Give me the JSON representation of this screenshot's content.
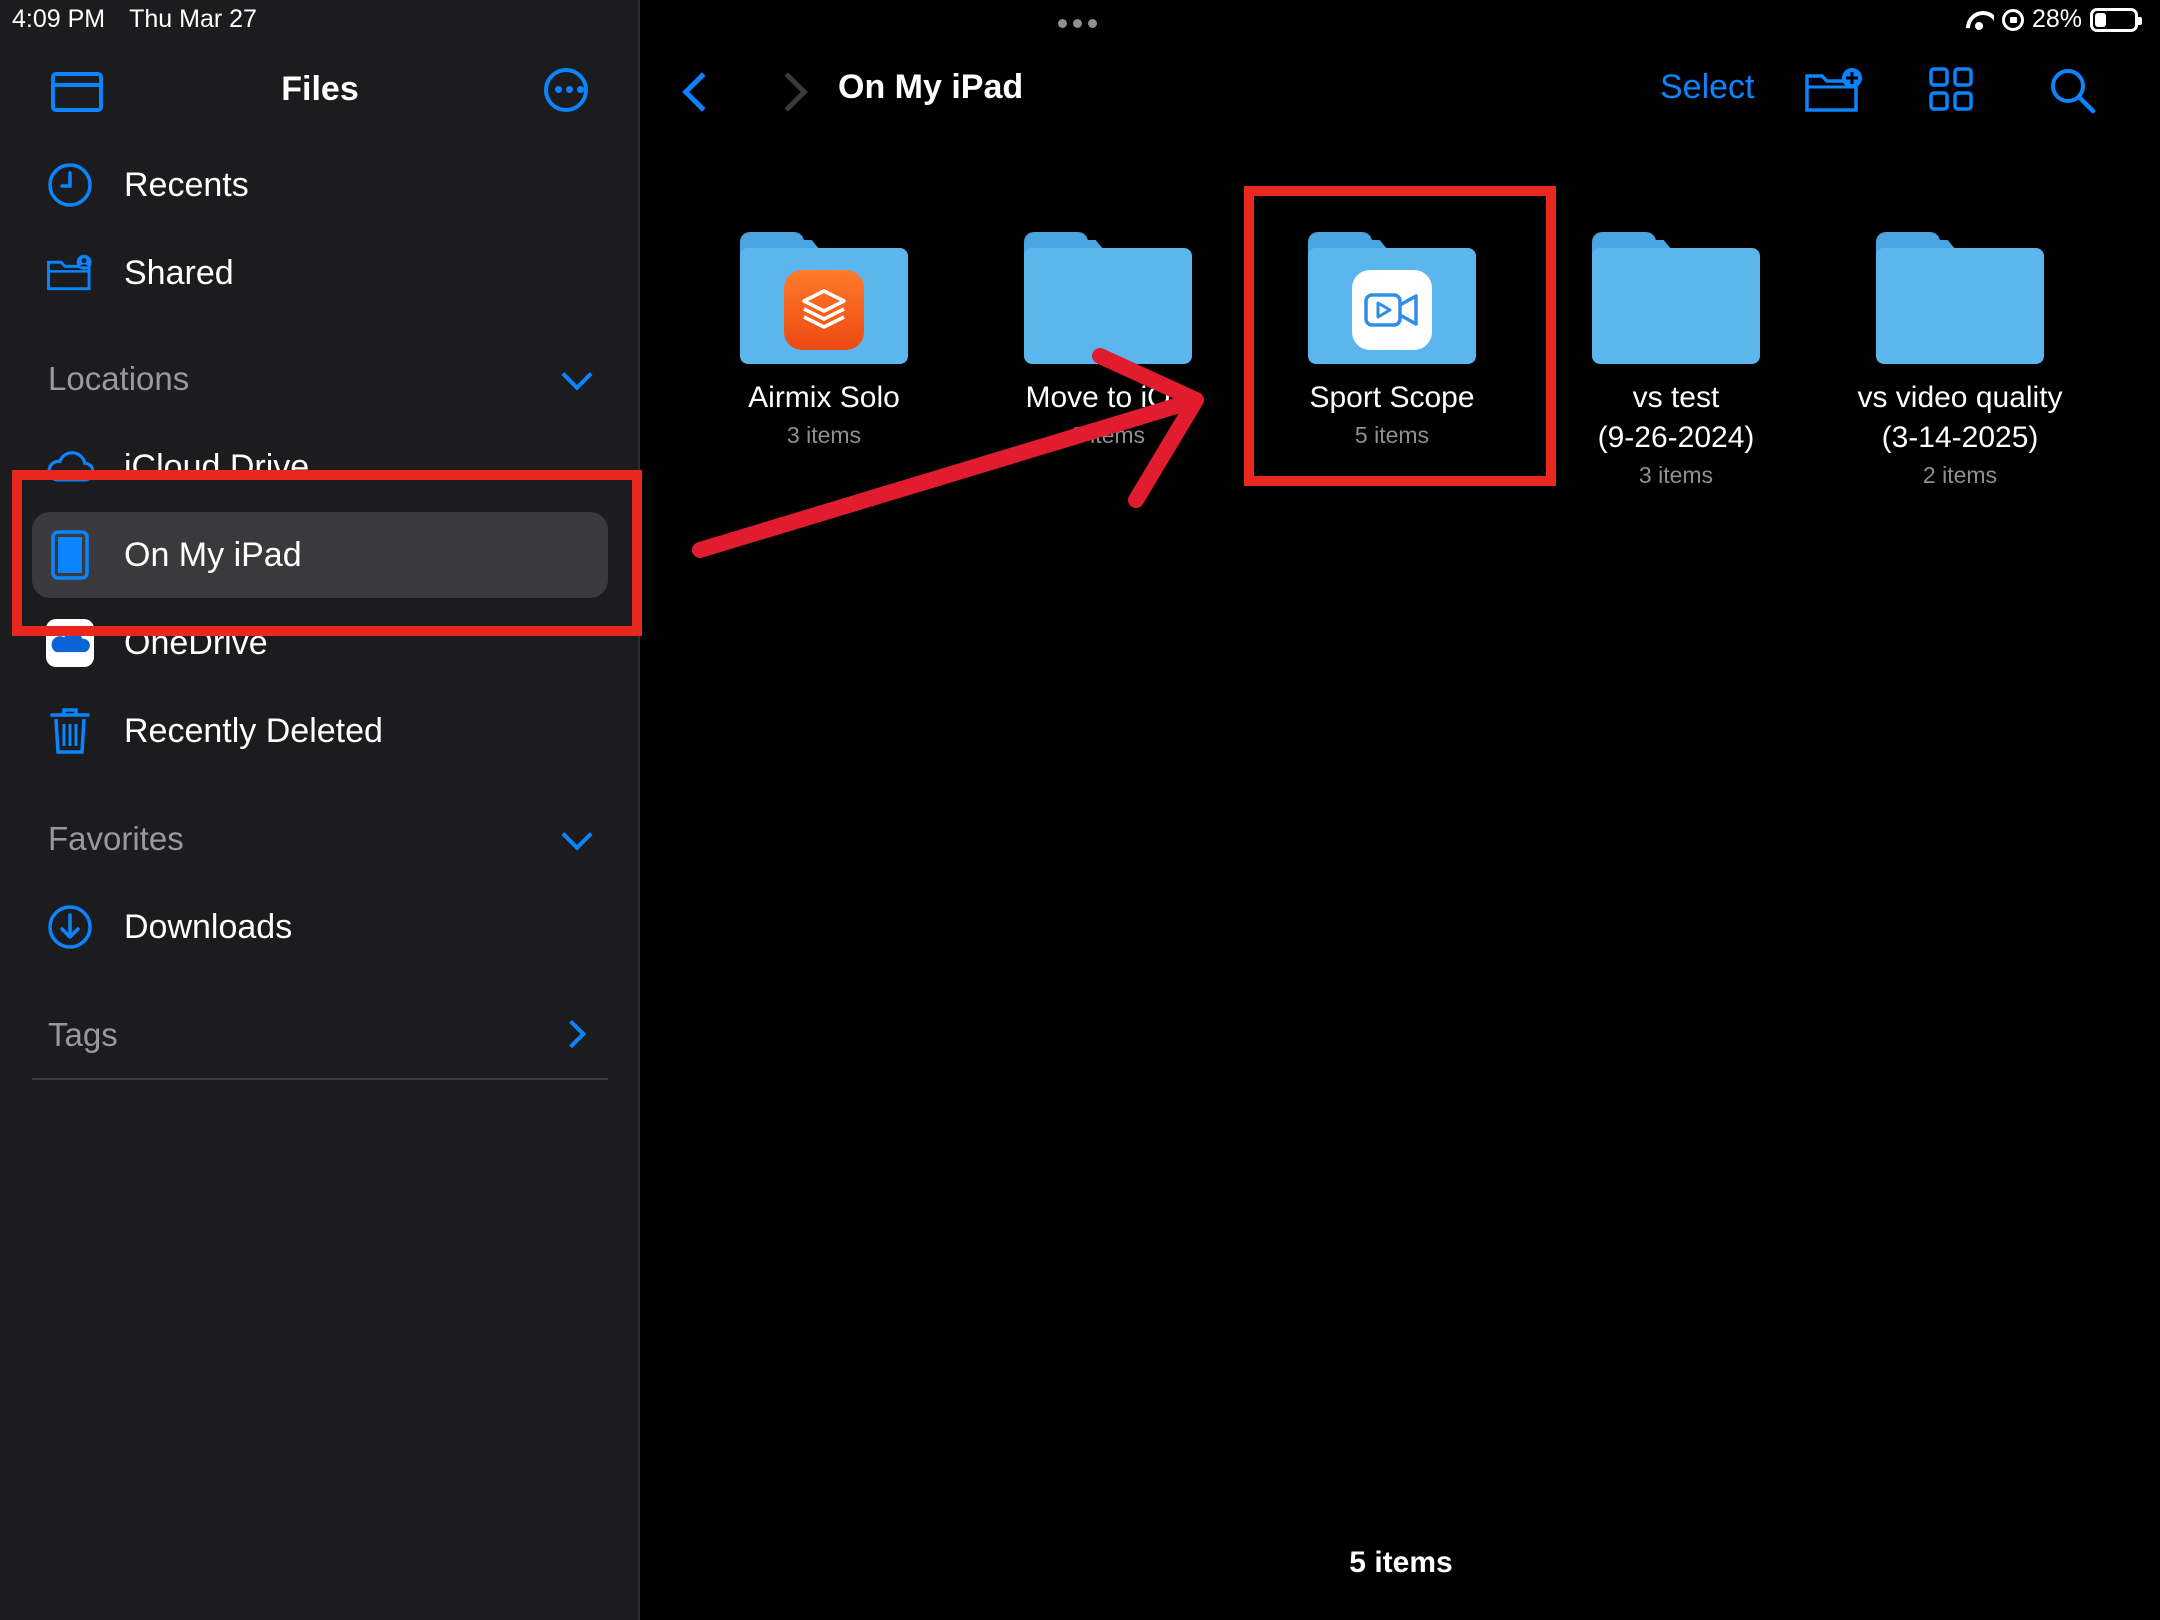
{
  "status": {
    "time": "4:09 PM",
    "date": "Thu Mar 27",
    "battery": "28%",
    "battery_level": 0.28
  },
  "sidebar": {
    "title": "Files",
    "top_items": [
      {
        "label": "Recents",
        "icon": "clock-icon"
      },
      {
        "label": "Shared",
        "icon": "shared-folder-icon"
      }
    ],
    "locations_header": "Locations",
    "locations": [
      {
        "label": "iCloud Drive",
        "icon": "cloud-icon"
      },
      {
        "label": "On My iPad",
        "icon": "ipad-icon",
        "selected": true
      },
      {
        "label": "OneDrive",
        "icon": "onedrive-icon"
      },
      {
        "label": "Recently Deleted",
        "icon": "trash-icon"
      }
    ],
    "favorites_header": "Favorites",
    "favorites": [
      {
        "label": "Downloads",
        "icon": "download-icon"
      }
    ],
    "tags_header": "Tags"
  },
  "main": {
    "title": "On My iPad",
    "select_label": "Select",
    "folders": [
      {
        "name": "Airmix Solo",
        "count": "3 items",
        "badge": "layers-app-icon"
      },
      {
        "name": "Move to iOS",
        "count": "0 items",
        "badge": ""
      },
      {
        "name": "Sport Scope",
        "count": "5 items",
        "badge": "video-app-icon"
      },
      {
        "name_line1": "vs test",
        "name_line2": "(9-26-2024)",
        "count": "3 items"
      },
      {
        "name_line1": "vs video quality",
        "name_line2": "(3-14-2025)",
        "count": "2 items"
      }
    ],
    "footer": "5 items"
  },
  "colors": {
    "accent": "#0a84ff",
    "sidebar_bg": "#1c1c1e",
    "folder": "#5cb6ee",
    "annotation": "#e8281e"
  }
}
